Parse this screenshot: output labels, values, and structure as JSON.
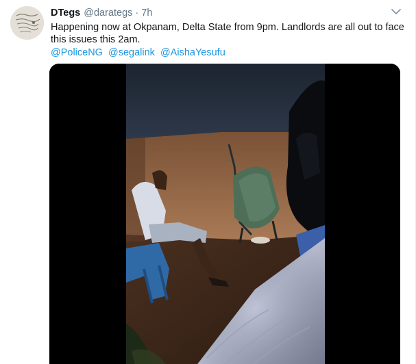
{
  "tweet": {
    "display_name": "DTegs",
    "handle": "@darategs",
    "separator": "·",
    "time": "7h",
    "text": "Happening now at Okpanam, Delta State from 9pm. Landlords are all out to face this issues this 2am.",
    "mentions": [
      "@PoliceNG",
      "@segalink",
      "@AishaYesufu"
    ]
  },
  "icons": {
    "caret": "chevron-down-icon",
    "avatar": "avatar"
  },
  "colors": {
    "link": "#1b95e0",
    "text": "#14171a",
    "muted": "#657786"
  }
}
